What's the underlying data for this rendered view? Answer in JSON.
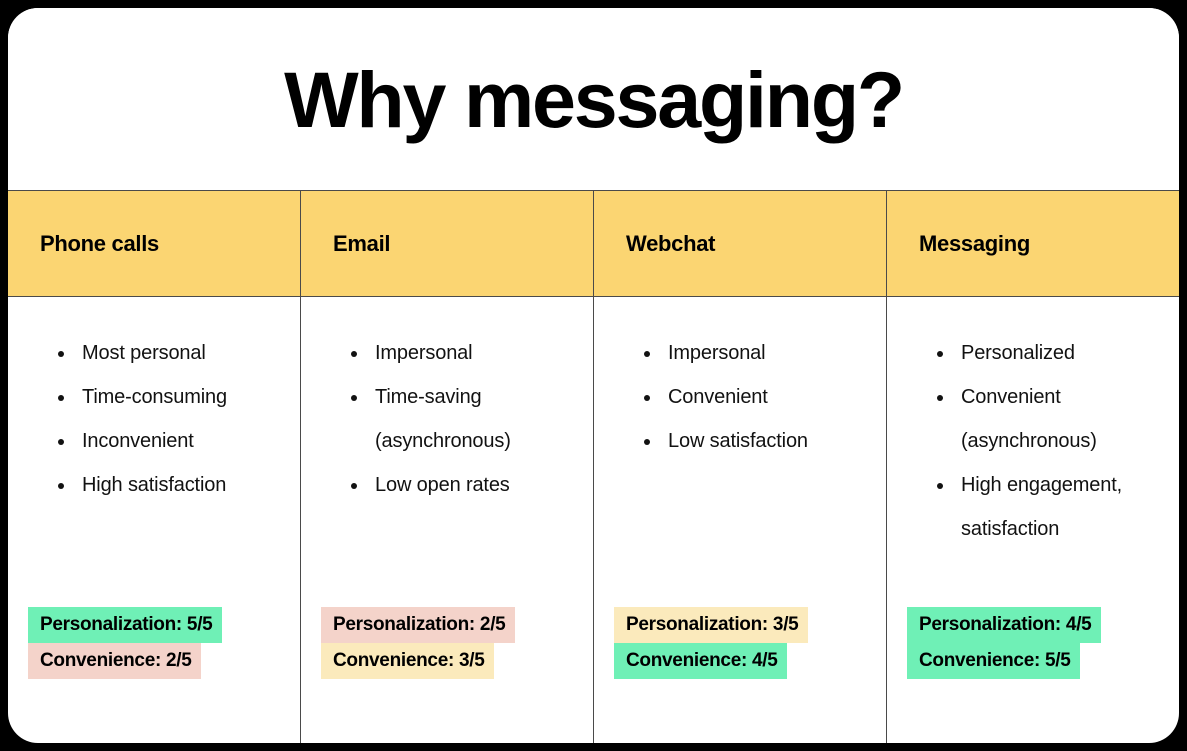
{
  "slide": {
    "title": "Why messaging?",
    "background_color": "#000000",
    "card_color": "#ffffff",
    "header_color": "#fbd572",
    "divider_color": "#4a4a4a"
  },
  "highlight_colors": {
    "green": "#6ff0b6",
    "pink": "#f4d3ca",
    "yellow": "#fbeabc"
  },
  "table": {
    "columns": [
      {
        "header": "Phone calls",
        "bullets": [
          "Most personal",
          "Time-consuming",
          "Inconvenient",
          "High satisfaction"
        ],
        "scores": [
          {
            "label": "Personalization: 5/5",
            "metric": "Personalization",
            "value": 5,
            "max": 5,
            "highlight": "green"
          },
          {
            "label": "Convenience: 2/5",
            "metric": "Convenience",
            "value": 2,
            "max": 5,
            "highlight": "pink"
          }
        ]
      },
      {
        "header": "Email",
        "bullets": [
          "Impersonal",
          "Time-saving (asynchronous)",
          "Low open rates"
        ],
        "scores": [
          {
            "label": "Personalization: 2/5",
            "metric": "Personalization",
            "value": 2,
            "max": 5,
            "highlight": "pink"
          },
          {
            "label": "Convenience: 3/5",
            "metric": "Convenience",
            "value": 3,
            "max": 5,
            "highlight": "yellow"
          }
        ]
      },
      {
        "header": "Webchat",
        "bullets": [
          "Impersonal",
          "Convenient",
          "Low satisfaction"
        ],
        "scores": [
          {
            "label": "Personalization: 3/5",
            "metric": "Personalization",
            "value": 3,
            "max": 5,
            "highlight": "yellow"
          },
          {
            "label": "Convenience: 4/5",
            "metric": "Convenience",
            "value": 4,
            "max": 5,
            "highlight": "green"
          }
        ]
      },
      {
        "header": "Messaging",
        "bullets": [
          "Personalized",
          "Convenient (asynchronous)",
          "High engagement, satisfaction"
        ],
        "scores": [
          {
            "label": "Personalization: 4/5",
            "metric": "Personalization",
            "value": 4,
            "max": 5,
            "highlight": "green"
          },
          {
            "label": "Convenience: 5/5",
            "metric": "Convenience",
            "value": 5,
            "max": 5,
            "highlight": "green"
          }
        ]
      }
    ]
  }
}
